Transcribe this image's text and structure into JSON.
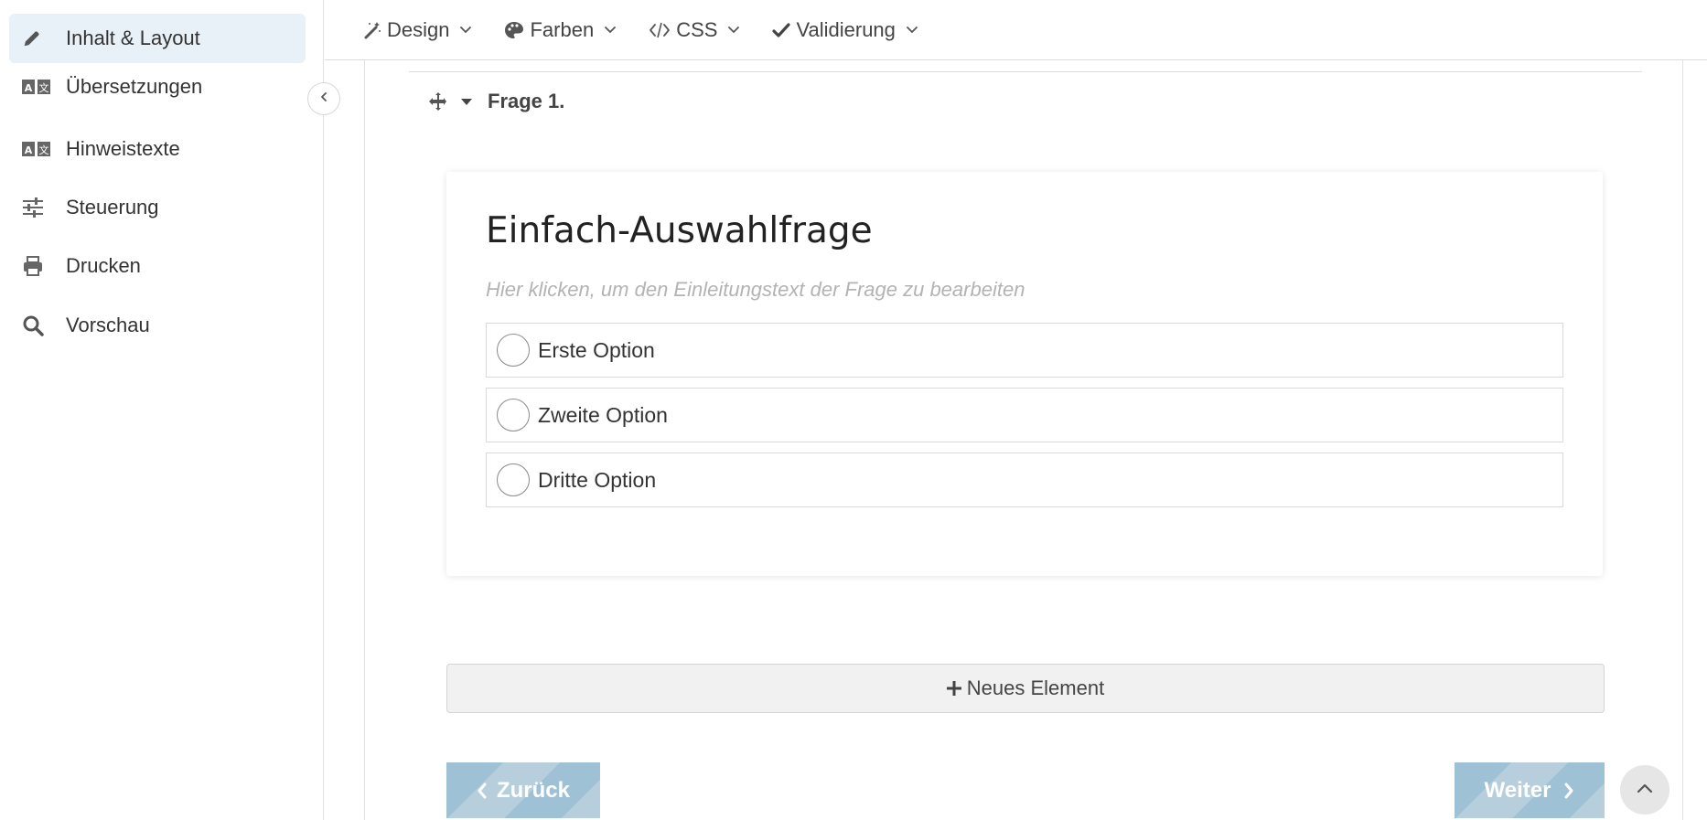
{
  "sidebar": {
    "items": [
      {
        "label": "Inhalt & Layout",
        "icon": "pencil-icon",
        "active": true
      },
      {
        "label": "Übersetzungen",
        "icon": "translate-icon",
        "active": false
      },
      {
        "label": "Hinweistexte",
        "icon": "translate-icon",
        "active": false
      },
      {
        "label": "Steuerung",
        "icon": "sliders-icon",
        "active": false
      },
      {
        "label": "Drucken",
        "icon": "printer-icon",
        "active": false
      },
      {
        "label": "Vorschau",
        "icon": "search-icon",
        "active": false
      }
    ],
    "collapse_icon": "chevron-left-icon"
  },
  "toolbar": {
    "items": [
      {
        "label": "Design",
        "icon": "magic-wand-icon"
      },
      {
        "label": "Farben",
        "icon": "palette-icon"
      },
      {
        "label": "CSS",
        "icon": "code-icon"
      },
      {
        "label": "Validierung",
        "icon": "check-icon"
      }
    ]
  },
  "question": {
    "header": "Frage 1.",
    "title": "Einfach-Auswahlfrage",
    "intro_placeholder": "Hier klicken, um den Einleitungstext der Frage zu bearbeiten",
    "options": [
      "Erste Option",
      "Zweite Option",
      "Dritte Option"
    ]
  },
  "actions": {
    "add_element": "Neues Element",
    "back": "Zurück",
    "next": "Weiter"
  },
  "colors": {
    "active_bg": "#e9f1f8",
    "nav_button": "#9fc1d5"
  }
}
